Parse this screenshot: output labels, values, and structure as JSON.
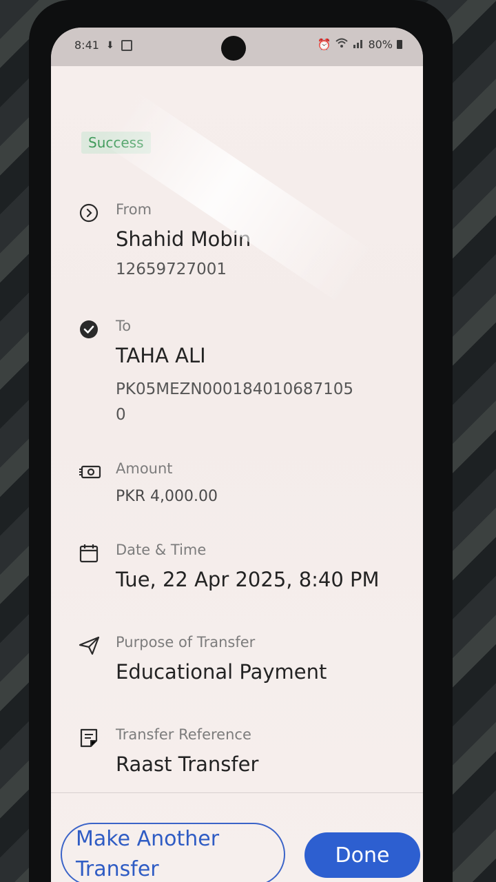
{
  "status_bar": {
    "time": "8:41",
    "battery": "80%"
  },
  "badge": "Success",
  "from": {
    "label": "From",
    "name": "Shahid Mobin",
    "account": "12659727001"
  },
  "to": {
    "label": "To",
    "name": "TAHA ALI",
    "account": "PK05MEZN000184010687105\n0"
  },
  "amount": {
    "label": "Amount",
    "value": "PKR 4,000.00"
  },
  "datetime": {
    "label": "Date & Time",
    "value": "Tue, 22 Apr 2025, 8:40 PM"
  },
  "purpose": {
    "label": "Purpose of Transfer",
    "value": "Educational Payment"
  },
  "reference": {
    "label": "Transfer Reference",
    "value": "Raast Transfer"
  },
  "actions": {
    "make_another_line1": "Make Another",
    "make_another_line2": "Transfer",
    "done": "Done"
  },
  "colors": {
    "success_text": "#3f9a5a",
    "success_bg": "#dde9de",
    "primary": "#2d5fd0"
  },
  "icons": [
    "arrow-circle-right-icon",
    "check-circle-icon",
    "money-icon",
    "calendar-icon",
    "send-icon",
    "document-icon"
  ]
}
